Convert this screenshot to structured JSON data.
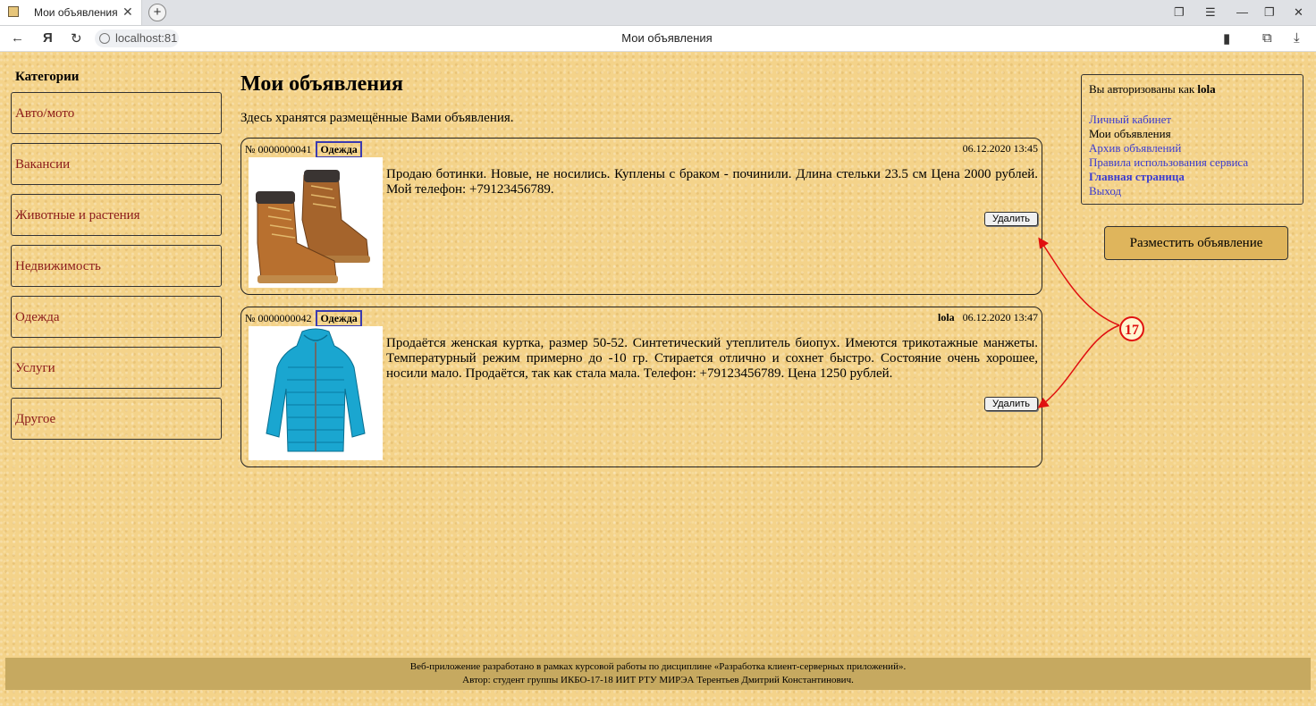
{
  "browser": {
    "tab_title": "Мои объявления",
    "url": "localhost:81",
    "page_title": "Мои объявления"
  },
  "sidebar": {
    "heading": "Категории",
    "items": [
      {
        "label": "Авто/мото"
      },
      {
        "label": "Вакансии"
      },
      {
        "label": "Животные и растения"
      },
      {
        "label": "Недвижимость"
      },
      {
        "label": "Одежда"
      },
      {
        "label": "Услуги"
      },
      {
        "label": "Другое"
      }
    ]
  },
  "main": {
    "title": "Мои объявления",
    "intro": "Здесь хранятся размещённые Вами объявления.",
    "ads": [
      {
        "number": "№ 0000000041",
        "category": "Одежда",
        "author": "",
        "date": "06.12.2020 13:45",
        "text": "Продаю ботинки. Новые, не носились. Куплены с браком - починили. Длина стельки 23.5 см Цена 2000 рублей. Мой телефон: +79123456789.",
        "delete_label": "Удалить",
        "image": "brown-boots"
      },
      {
        "number": "№ 0000000042",
        "category": "Одежда",
        "author": "lola",
        "date": "06.12.2020 13:47",
        "text": "Продаётся женская куртка, размер 50-52. Синтетический утеплитель биопух. Имеются трикотажные манжеты. Температурный режим примерно до -10 гр. Стирается отлично и сохнет быстро. Состояние очень хорошее, носили мало. Продаётся, так как стала мала. Телефон: +79123456789. Цена 1250 рублей.",
        "delete_label": "Удалить",
        "image": "blue-jacket"
      }
    ]
  },
  "userbox": {
    "auth_prefix": "Вы авторизованы как ",
    "username": "lola",
    "links": [
      {
        "label": "Личный кабинет"
      },
      {
        "label": "Мои объявления"
      },
      {
        "label": "Архив объявлений"
      },
      {
        "label": "Правила использования сервиса"
      },
      {
        "label": "Главная страница"
      },
      {
        "label": "Выход"
      }
    ]
  },
  "post_button": "Разместить объявление",
  "annotation": {
    "label": "17",
    "color": "#e01010"
  },
  "footer": {
    "line1": "Веб-приложение разработано в рамках курсовой работы по дисциплине «Разработка клиент-серверных приложений».",
    "line2": "Автор: студент группы ИКБО-17-18 ИИТ РТУ МИРЭА Терентьев Дмитрий Константинович."
  }
}
